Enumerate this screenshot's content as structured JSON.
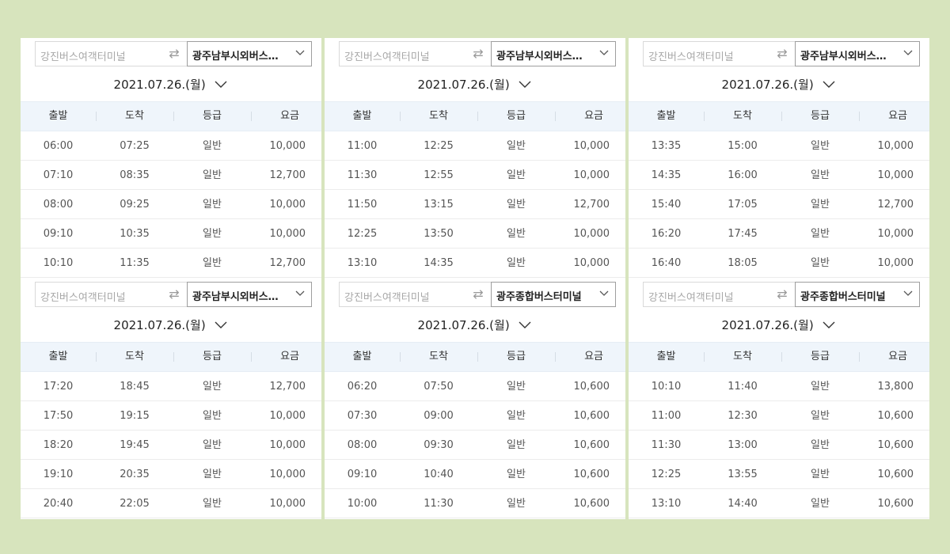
{
  "labels": {
    "depart": "출발",
    "arrive": "도착",
    "grade": "등급",
    "fare": "요금"
  },
  "panels": [
    {
      "origin": "강진버스여객터미널",
      "destination": "광주남부시외버스…",
      "date": "2021.07.26.(월)",
      "rows": [
        {
          "depart": "06:00",
          "arrive": "07:25",
          "grade": "일반",
          "fare": "10,000"
        },
        {
          "depart": "07:10",
          "arrive": "08:35",
          "grade": "일반",
          "fare": "12,700"
        },
        {
          "depart": "08:00",
          "arrive": "09:25",
          "grade": "일반",
          "fare": "10,000"
        },
        {
          "depart": "09:10",
          "arrive": "10:35",
          "grade": "일반",
          "fare": "10,000"
        },
        {
          "depart": "10:10",
          "arrive": "11:35",
          "grade": "일반",
          "fare": "12,700"
        }
      ]
    },
    {
      "origin": "강진버스여객터미널",
      "destination": "광주남부시외버스…",
      "date": "2021.07.26.(월)",
      "rows": [
        {
          "depart": "11:00",
          "arrive": "12:25",
          "grade": "일반",
          "fare": "10,000"
        },
        {
          "depart": "11:30",
          "arrive": "12:55",
          "grade": "일반",
          "fare": "10,000"
        },
        {
          "depart": "11:50",
          "arrive": "13:15",
          "grade": "일반",
          "fare": "12,700"
        },
        {
          "depart": "12:25",
          "arrive": "13:50",
          "grade": "일반",
          "fare": "10,000"
        },
        {
          "depart": "13:10",
          "arrive": "14:35",
          "grade": "일반",
          "fare": "10,000"
        }
      ]
    },
    {
      "origin": "강진버스여객터미널",
      "destination": "광주남부시외버스…",
      "date": "2021.07.26.(월)",
      "rows": [
        {
          "depart": "13:35",
          "arrive": "15:00",
          "grade": "일반",
          "fare": "10,000"
        },
        {
          "depart": "14:35",
          "arrive": "16:00",
          "grade": "일반",
          "fare": "10,000"
        },
        {
          "depart": "15:40",
          "arrive": "17:05",
          "grade": "일반",
          "fare": "12,700"
        },
        {
          "depart": "16:20",
          "arrive": "17:45",
          "grade": "일반",
          "fare": "10,000"
        },
        {
          "depart": "16:40",
          "arrive": "18:05",
          "grade": "일반",
          "fare": "10,000"
        }
      ]
    },
    {
      "origin": "강진버스여객터미널",
      "destination": "광주남부시외버스…",
      "date": "2021.07.26.(월)",
      "rows": [
        {
          "depart": "17:20",
          "arrive": "18:45",
          "grade": "일반",
          "fare": "12,700"
        },
        {
          "depart": "17:50",
          "arrive": "19:15",
          "grade": "일반",
          "fare": "10,000"
        },
        {
          "depart": "18:20",
          "arrive": "19:45",
          "grade": "일반",
          "fare": "10,000"
        },
        {
          "depart": "19:10",
          "arrive": "20:35",
          "grade": "일반",
          "fare": "10,000"
        },
        {
          "depart": "20:40",
          "arrive": "22:05",
          "grade": "일반",
          "fare": "10,000"
        }
      ]
    },
    {
      "origin": "강진버스여객터미널",
      "destination": "광주종합버스터미널",
      "date": "2021.07.26.(월)",
      "rows": [
        {
          "depart": "06:20",
          "arrive": "07:50",
          "grade": "일반",
          "fare": "10,600"
        },
        {
          "depart": "07:30",
          "arrive": "09:00",
          "grade": "일반",
          "fare": "10,600"
        },
        {
          "depart": "08:00",
          "arrive": "09:30",
          "grade": "일반",
          "fare": "10,600"
        },
        {
          "depart": "09:10",
          "arrive": "10:40",
          "grade": "일반",
          "fare": "10,600"
        },
        {
          "depart": "10:00",
          "arrive": "11:30",
          "grade": "일반",
          "fare": "10,600"
        }
      ]
    },
    {
      "origin": "강진버스여객터미널",
      "destination": "광주종합버스터미널",
      "date": "2021.07.26.(월)",
      "rows": [
        {
          "depart": "10:10",
          "arrive": "11:40",
          "grade": "일반",
          "fare": "13,800"
        },
        {
          "depart": "11:00",
          "arrive": "12:30",
          "grade": "일반",
          "fare": "10,600"
        },
        {
          "depart": "11:30",
          "arrive": "13:00",
          "grade": "일반",
          "fare": "10,600"
        },
        {
          "depart": "12:25",
          "arrive": "13:55",
          "grade": "일반",
          "fare": "10,600"
        },
        {
          "depart": "13:10",
          "arrive": "14:40",
          "grade": "일반",
          "fare": "10,600"
        }
      ]
    }
  ]
}
